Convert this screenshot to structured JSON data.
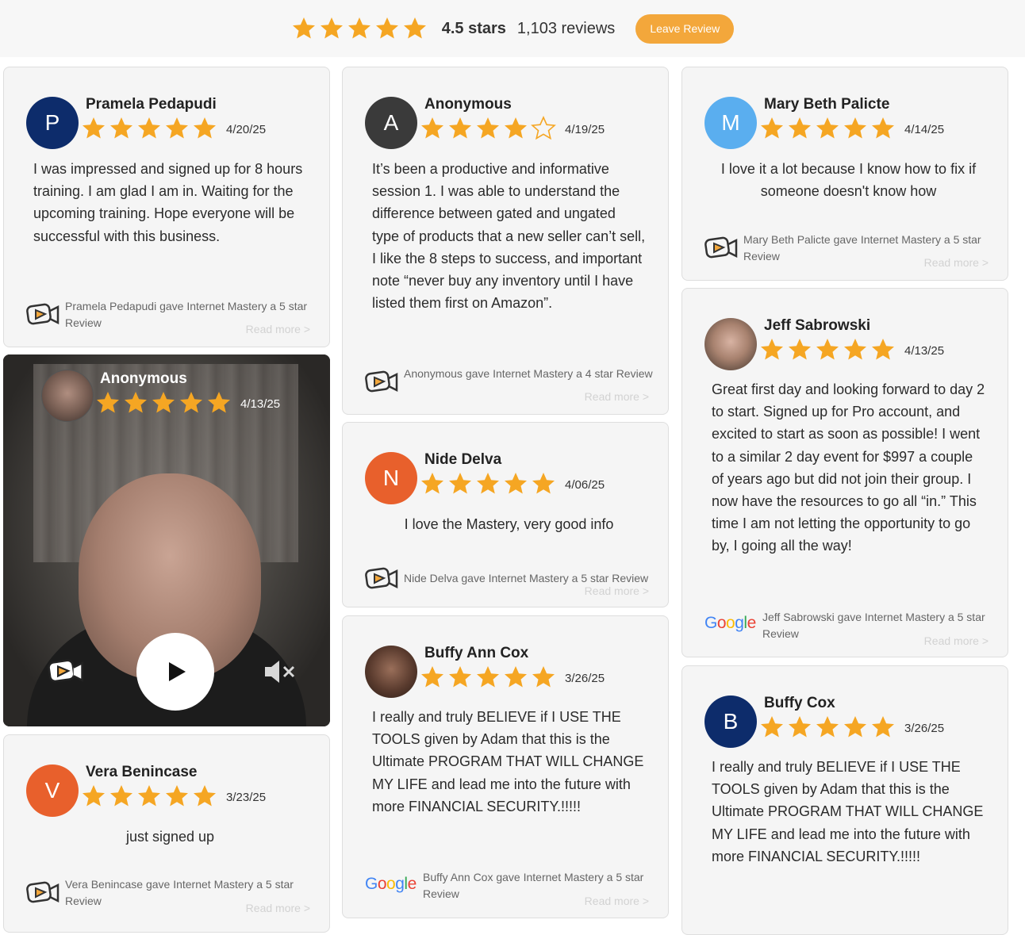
{
  "colors": {
    "star": "#f5a623",
    "accent": "#f3a73b",
    "blue_avatar": "#0d2c6b",
    "dark_avatar": "#3a3a3a",
    "light_blue_avatar": "#5aaeef",
    "orange_avatar": "#e8602c"
  },
  "summary": {
    "stars": 5,
    "rating_text": "4.5 stars",
    "reviews_count": "1,103 reviews",
    "leave_review_label": "Leave Review"
  },
  "reviews": [
    {
      "initial": "P",
      "name": "Pramela Pedapudi",
      "rating": 5,
      "date": "4/20/25",
      "text": "I was impressed and signed up for 8 hours training. I am glad I am in. Waiting for the upcoming training. Hope everyone will be successful with this business.",
      "source": "Pramela Pedapudi gave Internet Mastery a 5 star Review",
      "read_more": "Read more >"
    },
    {
      "name": "Anonymous",
      "rating": 5,
      "date": "4/13/25",
      "type": "video"
    },
    {
      "initial": "V",
      "name": "Vera Benincase",
      "rating": 5,
      "date": "3/23/25",
      "text": "just signed up",
      "source": "Vera Benincase gave Internet Mastery a 5 star Review",
      "read_more": "Read more >"
    },
    {
      "initial": "A",
      "name": "Anonymous",
      "rating": 4,
      "date": "4/19/25",
      "text": "It’s been a productive and informative session 1. I was able to understand the difference between gated and ungated type of products that a new seller can’t sell, I like the 8 steps to success, and important note “never buy any inventory until I have listed them first on Amazon”.",
      "source": "Anonymous gave Internet Mastery a 4 star Review",
      "read_more": "Read more >"
    },
    {
      "initial": "N",
      "name": "Nide Delva",
      "rating": 5,
      "date": "4/06/25",
      "text": "I love the Mastery, very good info",
      "source": "Nide Delva gave Internet Mastery a 5 star Review",
      "read_more": "Read more >"
    },
    {
      "name": "Buffy Ann Cox",
      "rating": 5,
      "date": "3/26/25",
      "text": "I really and truly BELIEVE if I USE THE TOOLS given by Adam that this is the Ultimate PROGRAM THAT WILL CHANGE MY LIFE and lead me into the future with more FINANCIAL SECURITY.!!!!!",
      "source": "Buffy Ann Cox gave Internet Mastery a 5 star Review",
      "read_more": "Read more >"
    },
    {
      "initial": "M",
      "name": "Mary Beth Palicte",
      "rating": 5,
      "date": "4/14/25",
      "text": "I love it a lot because I know how to fix if someone doesn't know how",
      "source": "Mary Beth Palicte gave Internet Mastery a 5 star Review",
      "read_more": "Read more >"
    },
    {
      "name": "Jeff Sabrowski",
      "rating": 5,
      "date": "4/13/25",
      "text": "Great first day and looking forward to day 2 to start. Signed up for Pro account, and excited to start as soon as possible! I went to a similar 2 day event for $997 a couple of years ago but did not join their group. I now have the resources to go all “in.” This time I am not letting the opportunity to go by, I going all the way!",
      "source": "Jeff Sabrowski gave Internet Mastery a 5 star Review",
      "read_more": "Read more >"
    },
    {
      "initial": "B",
      "name": "Buffy Cox",
      "rating": 5,
      "date": "3/26/25",
      "text": "I really and truly BELIEVE if I USE THE TOOLS given by Adam that this is the Ultimate PROGRAM THAT WILL CHANGE MY LIFE and lead me into the future with more FINANCIAL SECURITY.!!!!!"
    }
  ],
  "icons": {
    "star": "star-icon",
    "review_source": "video-review-icon",
    "google": "google-logo",
    "play": "play-icon",
    "mute": "mute-icon"
  }
}
